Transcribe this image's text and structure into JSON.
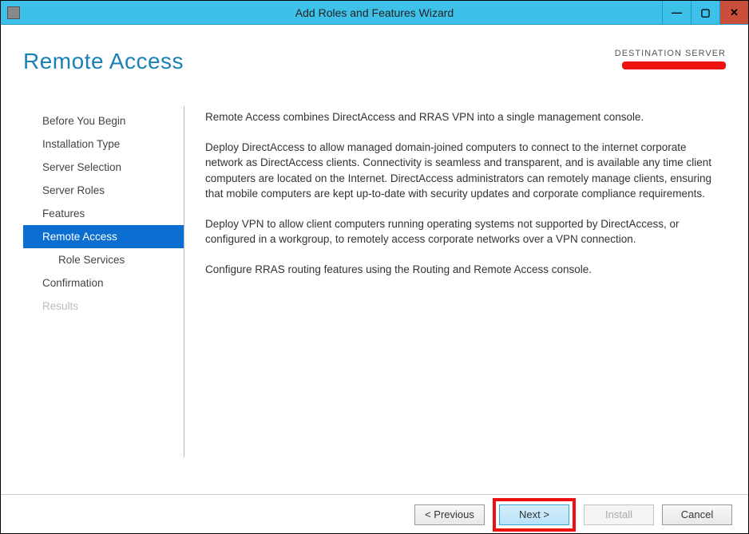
{
  "window": {
    "title": "Add Roles and Features Wizard"
  },
  "header": {
    "page_title": "Remote Access",
    "destination_label": "DESTINATION SERVER"
  },
  "sidebar": {
    "items": [
      {
        "label": "Before You Begin",
        "selected": false,
        "disabled": false,
        "indent": false
      },
      {
        "label": "Installation Type",
        "selected": false,
        "disabled": false,
        "indent": false
      },
      {
        "label": "Server Selection",
        "selected": false,
        "disabled": false,
        "indent": false
      },
      {
        "label": "Server Roles",
        "selected": false,
        "disabled": false,
        "indent": false
      },
      {
        "label": "Features",
        "selected": false,
        "disabled": false,
        "indent": false
      },
      {
        "label": "Remote Access",
        "selected": true,
        "disabled": false,
        "indent": false
      },
      {
        "label": "Role Services",
        "selected": false,
        "disabled": false,
        "indent": true
      },
      {
        "label": "Confirmation",
        "selected": false,
        "disabled": false,
        "indent": false
      },
      {
        "label": "Results",
        "selected": false,
        "disabled": true,
        "indent": false
      }
    ]
  },
  "main": {
    "p1": "Remote Access combines DirectAccess and RRAS VPN into a single management console.",
    "p2": "Deploy DirectAccess to allow managed domain-joined computers to connect to the internet corporate network as DirectAccess clients. Connectivity is seamless and transparent, and is available any time client computers are located on the Internet. DirectAccess administrators can remotely manage clients, ensuring that mobile computers are kept up-to-date with security updates and corporate compliance requirements.",
    "p3": "Deploy VPN to allow client computers running operating systems not supported by DirectAccess, or configured in a workgroup, to remotely access corporate networks over a VPN connection.",
    "p4": "Configure RRAS routing features using the Routing and Remote Access console."
  },
  "footer": {
    "previous": "< Previous",
    "next": "Next >",
    "install": "Install",
    "cancel": "Cancel"
  }
}
